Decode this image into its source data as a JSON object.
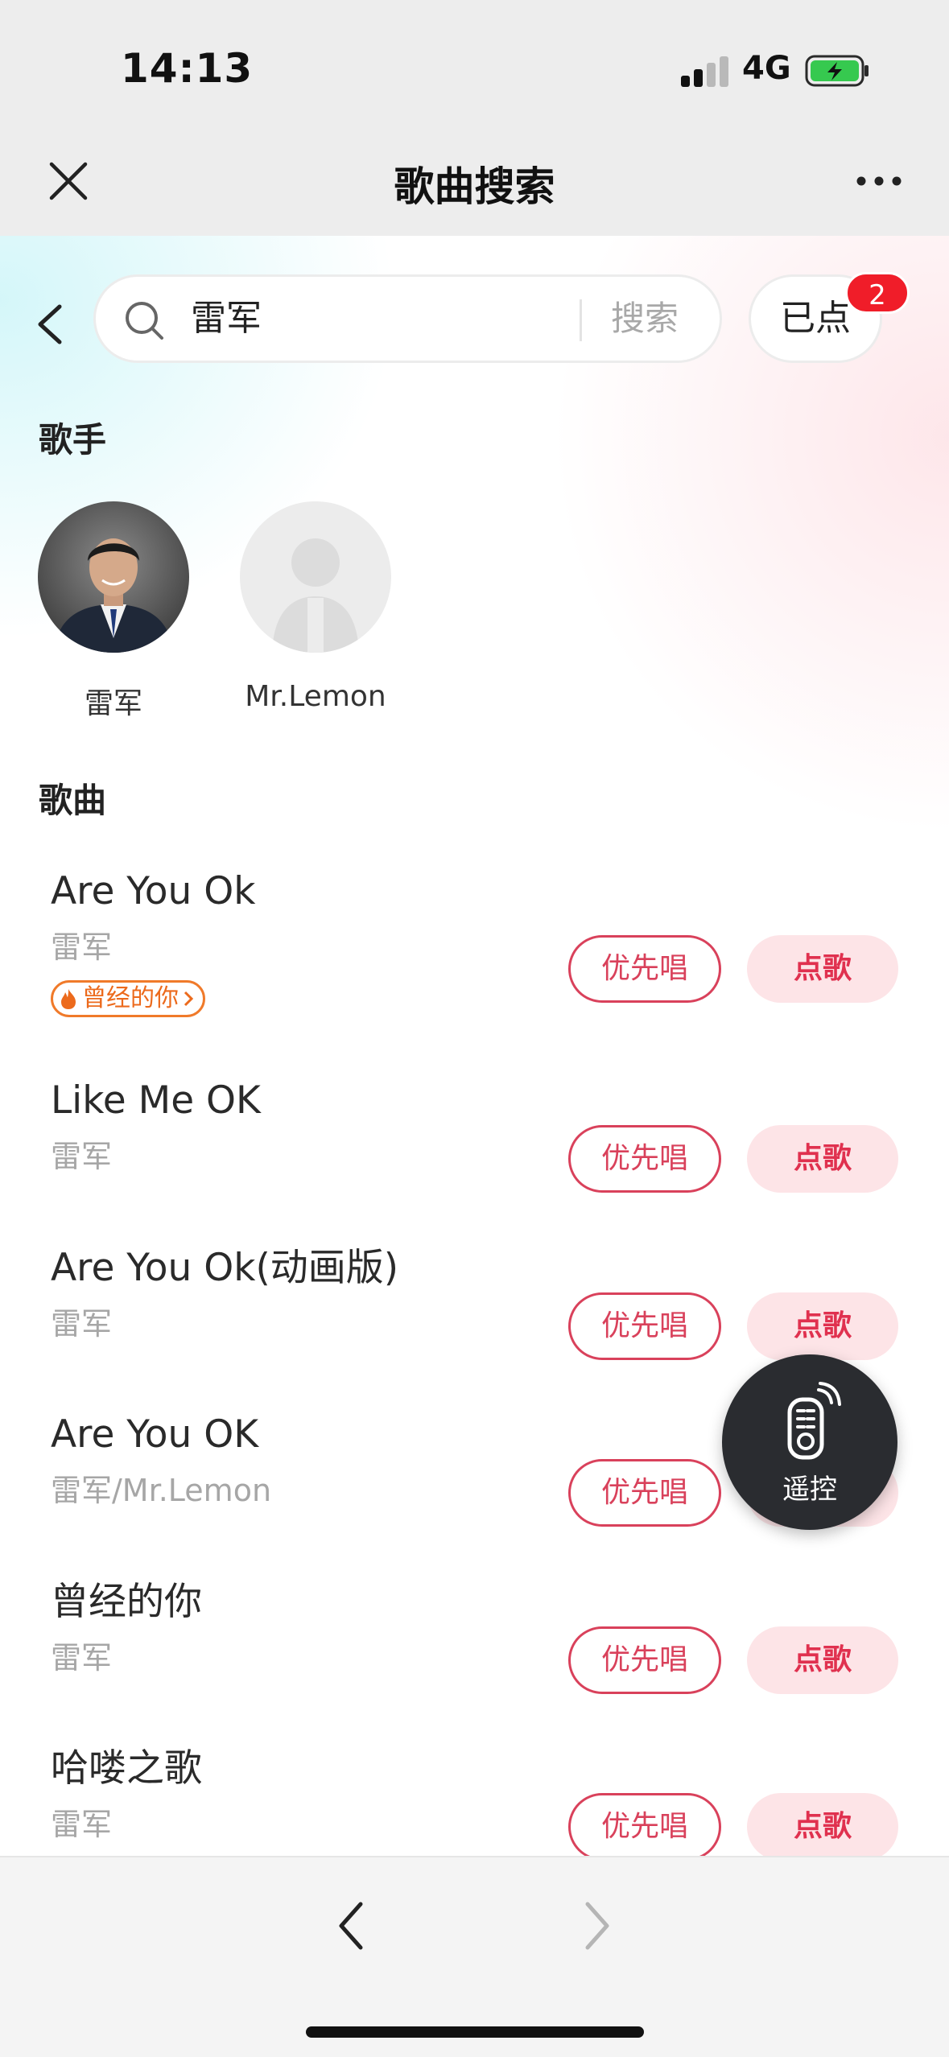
{
  "status_bar": {
    "time": "14:13",
    "network": "4G"
  },
  "header": {
    "title": "歌曲搜索"
  },
  "search": {
    "query": "雷军",
    "submit_label": "搜索"
  },
  "picked": {
    "label": "已点",
    "count": "2"
  },
  "artists_section": {
    "title": "歌手",
    "items": [
      {
        "name": "雷军"
      },
      {
        "name": "Mr.Lemon"
      }
    ]
  },
  "songs_section": {
    "title": "歌曲",
    "priority_label": "优先唱",
    "order_label": "点歌",
    "items": [
      {
        "title": "Are You Ok",
        "artist": "雷军",
        "tag": "曾经的你"
      },
      {
        "title": "Like Me OK",
        "artist": "雷军"
      },
      {
        "title": "Are You Ok(动画版)",
        "artist": "雷军"
      },
      {
        "title": "Are You OK",
        "artist": "雷军/Mr.Lemon"
      },
      {
        "title": "曾经的你",
        "artist": "雷军"
      },
      {
        "title": "哈喽之歌",
        "artist": "雷军"
      }
    ]
  },
  "remote": {
    "label": "遥控"
  },
  "colors": {
    "accent": "#d9415b",
    "order_bg": "#fde4e7",
    "badge": "#f01d29",
    "tag": "#ec6a1c"
  }
}
